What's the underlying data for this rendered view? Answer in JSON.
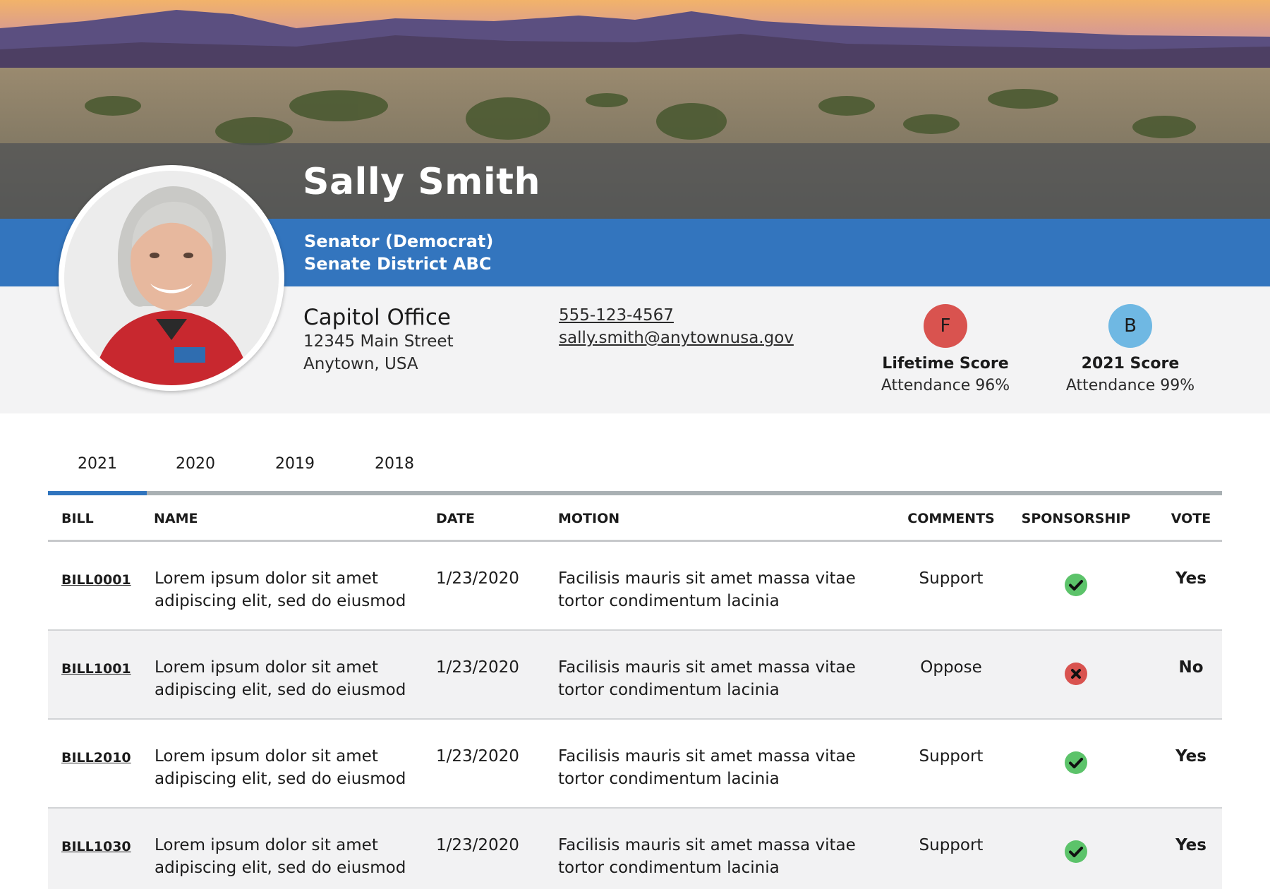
{
  "profile": {
    "name": "Sally Smith",
    "role": "Senator (Democrat)",
    "district": "Senate District ABC"
  },
  "office": {
    "title": "Capitol Office",
    "address_line1": "12345 Main Street",
    "address_line2": "Anytown, USA",
    "phone": "555-123-4567",
    "email": "sally.smith@anytownusa.gov"
  },
  "scores": [
    {
      "grade": "F",
      "label": "Lifetime Score",
      "attendance": "Attendance 96%",
      "color": "#d9534f"
    },
    {
      "grade": "B",
      "label": "2021 Score",
      "attendance": "Attendance 99%",
      "color": "#6fb8e3"
    }
  ],
  "tabs": [
    {
      "label": "2021",
      "active": true
    },
    {
      "label": "2020",
      "active": false
    },
    {
      "label": "2019",
      "active": false
    },
    {
      "label": "2018",
      "active": false
    }
  ],
  "table": {
    "headers": {
      "bill": "BILL",
      "name": "NAME",
      "date": "DATE",
      "motion": "MOTION",
      "comments": "COMMENTS",
      "sponsorship": "SPONSORSHIP",
      "vote": "VOTE"
    },
    "rows": [
      {
        "bill": "BILL0001",
        "name_line1": "Lorem ipsum dolor sit amet",
        "name_line2": "adipiscing elit, sed do eiusmod",
        "date": "1/23/2020",
        "motion_line1": "Facilisis mauris sit amet massa vitae",
        "motion_line2": "tortor condimentum lacinia",
        "comment": "Support",
        "sponsorship": "check-icon",
        "vote": "Yes"
      },
      {
        "bill": "BILL1001",
        "name_line1": "Lorem ipsum dolor sit amet",
        "name_line2": "adipiscing elit, sed do eiusmod",
        "date": "1/23/2020",
        "motion_line1": "Facilisis mauris sit amet massa vitae",
        "motion_line2": "tortor condimentum lacinia",
        "comment": "Oppose",
        "sponsorship": "x-icon",
        "vote": "No"
      },
      {
        "bill": "BILL2010",
        "name_line1": "Lorem ipsum dolor sit amet",
        "name_line2": "adipiscing elit, sed do eiusmod",
        "date": "1/23/2020",
        "motion_line1": "Facilisis mauris sit amet massa vitae",
        "motion_line2": "tortor condimentum lacinia",
        "comment": "Support",
        "sponsorship": "check-icon",
        "vote": "Yes"
      },
      {
        "bill": "BILL1030",
        "name_line1": "Lorem ipsum dolor sit amet",
        "name_line2": "adipiscing elit, sed do eiusmod",
        "date": "1/23/2020",
        "motion_line1": "Facilisis mauris sit amet massa vitae",
        "motion_line2": "tortor condimentum lacinia",
        "comment": "Support",
        "sponsorship": "check-icon",
        "vote": "Yes"
      }
    ]
  },
  "colors": {
    "brand_blue": "#3375be",
    "tab_active": "#2f74be",
    "support_green": "#5cc36a",
    "oppose_red": "#d9534f"
  }
}
